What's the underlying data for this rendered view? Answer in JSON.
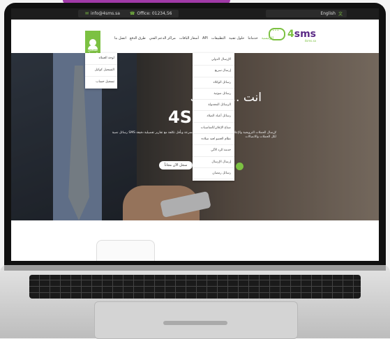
{
  "topbar": {
    "email": "info@4sms.sa",
    "phone": "Office: 01234,56",
    "language": "English"
  },
  "brand": {
    "name_prefix": "4",
    "name": "sms",
    "tagline": "4sms.sa"
  },
  "nav": {
    "items": [
      {
        "label": "الرئيسية",
        "active": true
      },
      {
        "label": "خدماتنا"
      },
      {
        "label": "حلول تقنية"
      },
      {
        "label": "التطبيقات"
      },
      {
        "label": "API"
      },
      {
        "label": "أسعار الباقات"
      },
      {
        "label": "مراكز الدعم الفني"
      },
      {
        "label": "طرق الدفع"
      },
      {
        "label": "اتصل بنا"
      }
    ],
    "login_label": "تسجيل الدخول"
  },
  "login_dropdown": [
    "لوحة العملاء",
    "التسجيل كوكيل",
    "تسجيل حساب"
  ],
  "services_dropdown": [
    "الإرسال الدولي",
    "إرسال سريع",
    "رسائل الوكلاء",
    "رسائل صوتية",
    "الرسائل المجدولة",
    "رسائل أعياد الميلاد",
    "صناع الإعلان/المناسبات",
    "نظام العضو لعيد ميلاده",
    "خدمة الرد الآلي",
    "إرسال الإرسال",
    "رسائل رمضان"
  ],
  "hero": {
    "title": "انت ... عملائك",
    "brand_word": "4S",
    "description": "رسائل نصية SMS لإرسال الحملات الترويجية والإعلانية والتنبيهات والرسائل الإدارية بسرعة وبأقل تكلفة مع تقارير تفصيلية دقيقة لكل الحملات والاتصالات",
    "cta": "سجل الآن مجاناً"
  }
}
